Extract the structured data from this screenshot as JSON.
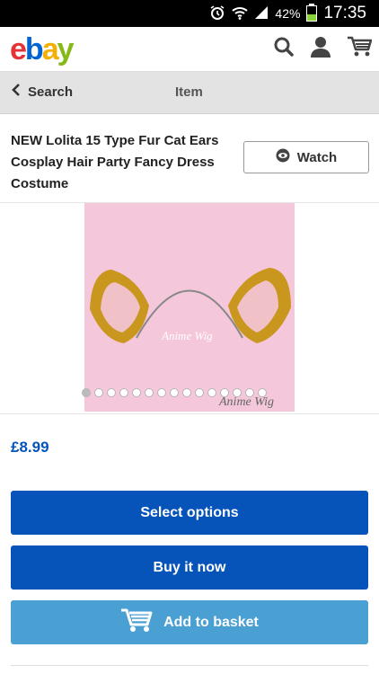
{
  "status_bar": {
    "battery": "42%",
    "time": "17:35",
    "battery_level": 0.42
  },
  "app_bar": {
    "logo": {
      "e": "e",
      "b": "b",
      "a": "a",
      "y": "y"
    },
    "icons": [
      "search-icon",
      "account-icon",
      "cart-icon"
    ]
  },
  "nav": {
    "back_label": "Search",
    "title": "Item"
  },
  "item": {
    "title": "NEW Lolita 15 Type Fur Cat Ears Cosplay Hair Party Fancy Dress Costume",
    "watch_label": "Watch",
    "price": "£8.99",
    "watermark_center": "Anime Wig",
    "watermark_corner": "Anime Wig",
    "gallery": {
      "total": 15,
      "active": 1
    }
  },
  "actions": {
    "select_options": "Select options",
    "buy_now": "Buy it now",
    "add_to_basket": "Add to basket"
  },
  "colors": {
    "ebay_red": "#e53238",
    "ebay_blue": "#0064d2",
    "ebay_yellow": "#f5af02",
    "ebay_green": "#86b817",
    "primary_button": "#0654ba",
    "basket_button": "#4a9fd3",
    "price": "#0654ba"
  }
}
